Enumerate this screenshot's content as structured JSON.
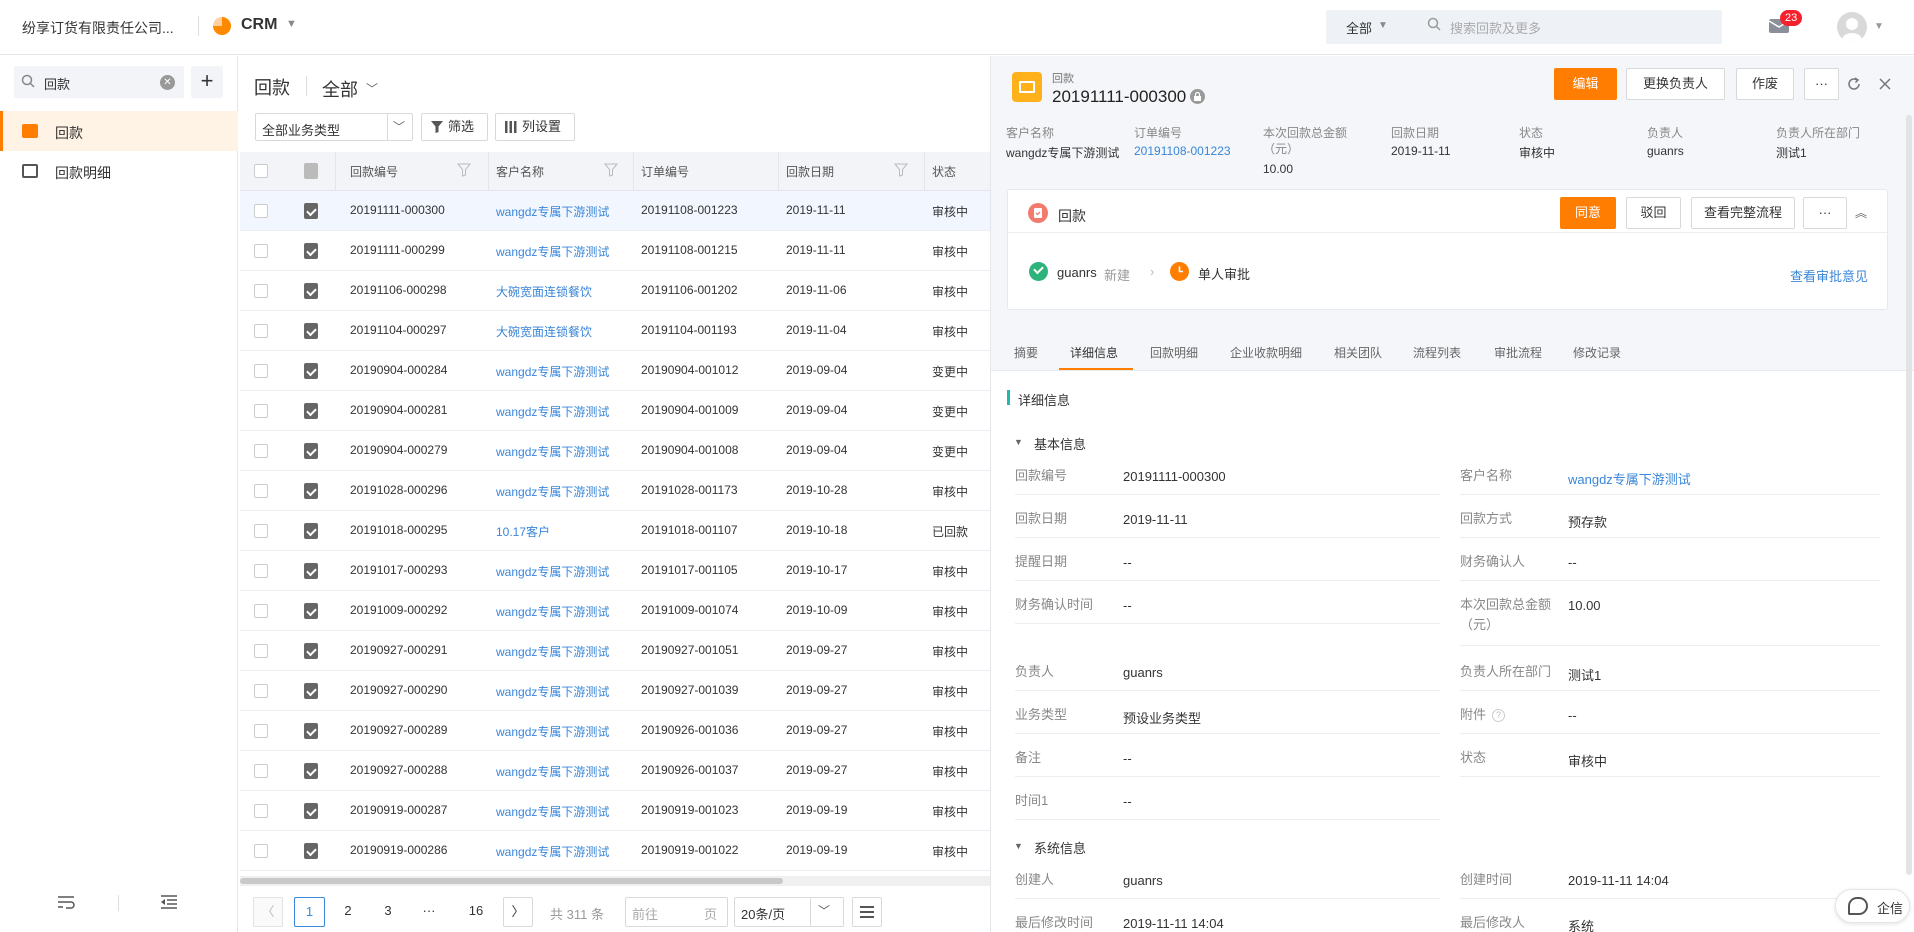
{
  "topbar": {
    "company": "纷享订货有限责任公司...",
    "app_title": "CRM",
    "search_scope": "全部",
    "search_placeholder": "搜索回款及更多",
    "mail_badge": "23"
  },
  "sidebar": {
    "search_value": "回款",
    "items": [
      {
        "label": "回款",
        "active": true
      },
      {
        "label": "回款明细",
        "active": false
      }
    ]
  },
  "list": {
    "title": "回款",
    "view": "全部",
    "type_select": "全部业务类型",
    "filter_label": "筛选",
    "colset_label": "列设置",
    "columns": [
      "回款编号",
      "客户名称",
      "订单编号",
      "回款日期",
      "状态"
    ],
    "rows": [
      {
        "code": "20191111-000300",
        "customer": "wangdz专属下游测试",
        "order": "20191108-001223",
        "date": "2019-11-11",
        "status": "审核中",
        "selected": true
      },
      {
        "code": "20191111-000299",
        "customer": "wangdz专属下游测试",
        "order": "20191108-001215",
        "date": "2019-11-11",
        "status": "审核中"
      },
      {
        "code": "20191106-000298",
        "customer": "大碗宽面连锁餐饮",
        "order": "20191106-001202",
        "date": "2019-11-06",
        "status": "审核中"
      },
      {
        "code": "20191104-000297",
        "customer": "大碗宽面连锁餐饮",
        "order": "20191104-001193",
        "date": "2019-11-04",
        "status": "审核中"
      },
      {
        "code": "20190904-000284",
        "customer": "wangdz专属下游测试",
        "order": "20190904-001012",
        "date": "2019-09-04",
        "status": "变更中"
      },
      {
        "code": "20190904-000281",
        "customer": "wangdz专属下游测试",
        "order": "20190904-001009",
        "date": "2019-09-04",
        "status": "变更中"
      },
      {
        "code": "20190904-000279",
        "customer": "wangdz专属下游测试",
        "order": "20190904-001008",
        "date": "2019-09-04",
        "status": "变更中"
      },
      {
        "code": "20191028-000296",
        "customer": "wangdz专属下游测试",
        "order": "20191028-001173",
        "date": "2019-10-28",
        "status": "审核中"
      },
      {
        "code": "20191018-000295",
        "customer": "10.17客户",
        "order": "20191018-001107",
        "date": "2019-10-18",
        "status": "已回款"
      },
      {
        "code": "20191017-000293",
        "customer": "wangdz专属下游测试",
        "order": "20191017-001105",
        "date": "2019-10-17",
        "status": "审核中"
      },
      {
        "code": "20191009-000292",
        "customer": "wangdz专属下游测试",
        "order": "20191009-001074",
        "date": "2019-10-09",
        "status": "审核中"
      },
      {
        "code": "20190927-000291",
        "customer": "wangdz专属下游测试",
        "order": "20190927-001051",
        "date": "2019-09-27",
        "status": "审核中"
      },
      {
        "code": "20190927-000290",
        "customer": "wangdz专属下游测试",
        "order": "20190927-001039",
        "date": "2019-09-27",
        "status": "审核中"
      },
      {
        "code": "20190927-000289",
        "customer": "wangdz专属下游测试",
        "order": "20190926-001036",
        "date": "2019-09-27",
        "status": "审核中"
      },
      {
        "code": "20190927-000288",
        "customer": "wangdz专属下游测试",
        "order": "20190926-001037",
        "date": "2019-09-27",
        "status": "审核中"
      },
      {
        "code": "20190919-000287",
        "customer": "wangdz专属下游测试",
        "order": "20190919-001023",
        "date": "2019-09-19",
        "status": "审核中"
      },
      {
        "code": "20190919-000286",
        "customer": "wangdz专属下游测试",
        "order": "20190919-001022",
        "date": "2019-09-19",
        "status": "审核中"
      }
    ]
  },
  "pager": {
    "current": "1",
    "pages": [
      "2",
      "3",
      "···",
      "16"
    ],
    "total": "共 311 条",
    "goto_placeholder": "前往",
    "goto_unit": "页",
    "page_size": "20条/页"
  },
  "detail": {
    "object_type": "回款",
    "title": "20191111-000300",
    "buttons": {
      "edit": "编辑",
      "change_owner": "更换负责人",
      "void": "作废",
      "more": "···"
    },
    "summary": [
      {
        "label": "客户名称",
        "value": "wangdz专属下游测试",
        "link": false
      },
      {
        "label": "订单编号",
        "value": "20191108-001223",
        "link": true
      },
      {
        "label": "本次回款总金额（元）",
        "value": "10.00",
        "link": false
      },
      {
        "label": "回款日期",
        "value": "2019-11-11",
        "link": false
      },
      {
        "label": "状态",
        "value": "审核中",
        "link": false
      },
      {
        "label": "负责人",
        "value": "guanrs",
        "link": false
      },
      {
        "label": "负责人所在部门",
        "value": "测试1",
        "link": false
      }
    ],
    "approval": {
      "title": "回款",
      "agree": "同意",
      "reject": "驳回",
      "view_flow": "查看完整流程",
      "more": "···",
      "done_user": "guanrs",
      "done_action": "新建",
      "current_step": "单人审批",
      "view_opinion": "查看审批意见"
    },
    "tabs": [
      "摘要",
      "详细信息",
      "回款明细",
      "企业收款明细",
      "相关团队",
      "流程列表",
      "审批流程",
      "修改记录"
    ],
    "active_tab": "详细信息",
    "section_title": "详细信息",
    "basic_group": "基本信息",
    "system_group": "系统信息",
    "fields_left": [
      {
        "label": "回款编号",
        "value": "20191111-000300"
      },
      {
        "label": "回款日期",
        "value": "2019-11-11"
      },
      {
        "label": "提醒日期",
        "value": "--"
      },
      {
        "label": "财务确认时间",
        "value": "--"
      },
      {
        "label": "负责人",
        "value": "guanrs"
      },
      {
        "label": "业务类型",
        "value": "预设业务类型"
      },
      {
        "label": "备注",
        "value": "--"
      },
      {
        "label": "时间1",
        "value": "--"
      }
    ],
    "fields_right": [
      {
        "label": "客户名称",
        "value": "wangdz专属下游测试",
        "link": true
      },
      {
        "label": "回款方式",
        "value": "预存款"
      },
      {
        "label": "财务确认人",
        "value": "--"
      },
      {
        "label": "本次回款总金额（元）",
        "value": "10.00"
      },
      {
        "label": "负责人所在部门",
        "value": "测试1"
      },
      {
        "label": "附件",
        "value": "--"
      },
      {
        "label": "状态",
        "value": "审核中"
      }
    ],
    "system_left": [
      {
        "label": "创建人",
        "value": "guanrs"
      },
      {
        "label": "最后修改时间",
        "value": "2019-11-11 14:04"
      }
    ],
    "system_right": [
      {
        "label": "创建时间",
        "value": "2019-11-11 14:04"
      },
      {
        "label": "最后修改人",
        "value": "系统"
      }
    ]
  },
  "floating": {
    "qixin_label": "企信"
  },
  "colors": {
    "accent": "#ff7d00",
    "link": "#3a86d8",
    "success": "#2db37b"
  }
}
